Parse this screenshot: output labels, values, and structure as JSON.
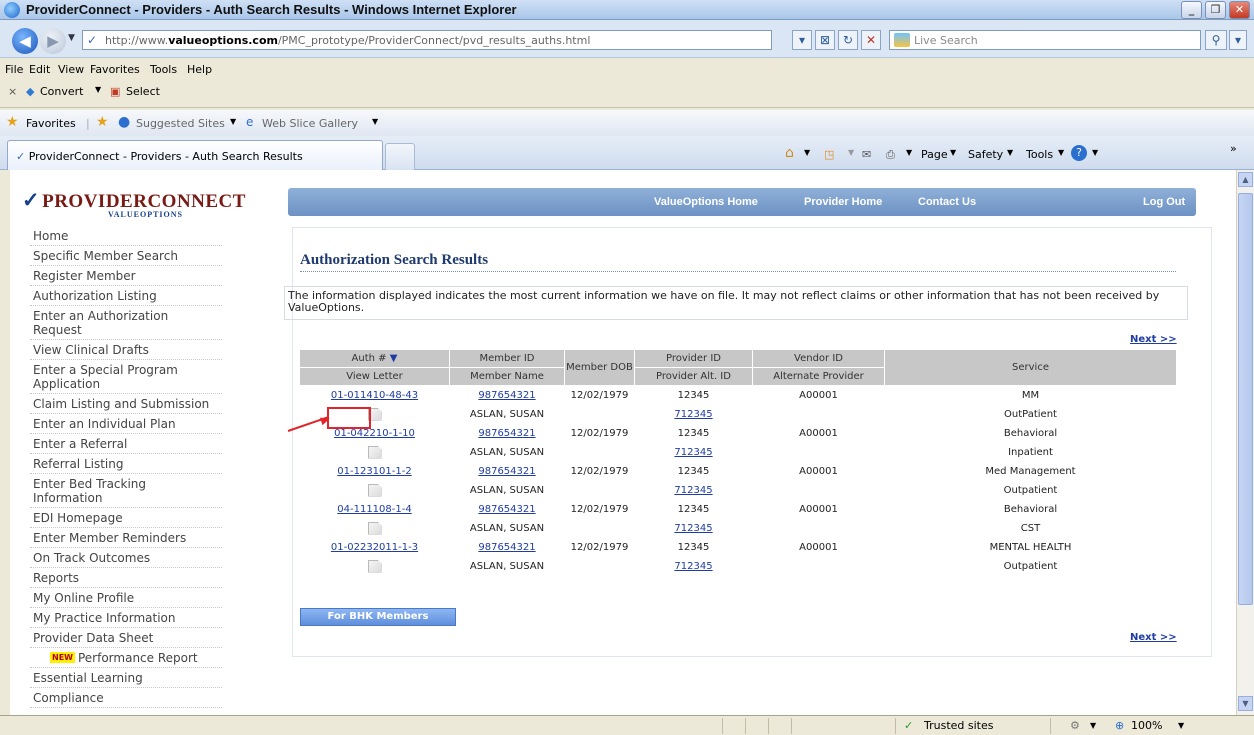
{
  "window": {
    "title": "ProviderConnect - Providers - Auth Search Results - Windows Internet Explorer"
  },
  "address": {
    "url_prefix": "http://www.",
    "url_domain": "valueoptions.com",
    "url_path": "/PMC_prototype/ProviderConnect/pvd_results_auths.html"
  },
  "search": {
    "placeholder": "Live Search"
  },
  "menu": [
    "File",
    "Edit",
    "View",
    "Favorites",
    "Tools",
    "Help"
  ],
  "commands": {
    "close": "×",
    "convert": "Convert",
    "select": "Select"
  },
  "favorites_bar": {
    "favorites": "Favorites",
    "suggested": "Suggested Sites",
    "gallery": "Web Slice Gallery"
  },
  "tab": {
    "label": "ProviderConnect - Providers - Auth Search Results"
  },
  "tab_tools": {
    "page": "Page",
    "safety": "Safety",
    "tools": "Tools"
  },
  "status": {
    "zone": "Trusted sites",
    "zoom": "100%"
  },
  "logo": {
    "name": "PROVIDERCONNECT",
    "sub": "VALUEOPTIONS"
  },
  "topnav": [
    "ValueOptions Home",
    "Provider Home",
    "Contact Us",
    "Log Out"
  ],
  "sidenav": [
    "Home",
    "Specific Member Search",
    "Register Member",
    "Authorization Listing",
    "Enter an Authorization Request",
    "View Clinical Drafts",
    "Enter a Special Program Application",
    "Claim Listing and Submission",
    "Enter an Individual Plan",
    "Enter a Referral",
    "Referral Listing",
    "Enter Bed Tracking Information",
    "EDI Homepage",
    "Enter Member Reminders",
    "On Track Outcomes",
    "Reports",
    "My Online Profile",
    "My Practice Information",
    "Provider Data Sheet",
    "Performance Report",
    "Essential Learning",
    "Compliance"
  ],
  "new_badge": "NEW",
  "page": {
    "title": "Authorization Search Results",
    "notice": "The information displayed indicates the most current information we have on file. It may not reflect claims or other information that has not been received by ValueOptions.",
    "next": "Next >>",
    "bhk_button": "For BHK Members"
  },
  "table": {
    "headers_top": [
      "Auth #",
      "Member ID",
      "Member DOB",
      "Provider ID",
      "Vendor ID",
      "Service"
    ],
    "headers_bottom": [
      "View Letter",
      "Member Name",
      "Provider Alt. ID",
      "Alternate Provider"
    ],
    "sort_glyph": "▼",
    "rows": [
      {
        "auth": "01-011410-48-43",
        "member_id": "987654321",
        "dob": "12/02/1979",
        "provider_id": "12345",
        "vendor_id": "A00001",
        "service": "MM",
        "name": "ASLAN, SUSAN",
        "alt_id": "712345",
        "service2": "OutPatient"
      },
      {
        "auth": "01-042210-1-10",
        "member_id": "987654321",
        "dob": "12/02/1979",
        "provider_id": "12345",
        "vendor_id": "A00001",
        "service": "Behavioral",
        "name": "ASLAN, SUSAN",
        "alt_id": "712345",
        "service2": "Inpatient"
      },
      {
        "auth": "01-123101-1-2",
        "member_id": "987654321",
        "dob": "12/02/1979",
        "provider_id": "12345",
        "vendor_id": "A00001",
        "service": "Med Management",
        "name": "ASLAN, SUSAN",
        "alt_id": "712345",
        "service2": "Outpatient"
      },
      {
        "auth": "04-111108-1-4",
        "member_id": "987654321",
        "dob": "12/02/1979",
        "provider_id": "12345",
        "vendor_id": "A00001",
        "service": "Behavioral",
        "name": "ASLAN, SUSAN",
        "alt_id": "712345",
        "service2": "CST"
      },
      {
        "auth": "01-02232011-1-3",
        "member_id": "987654321",
        "dob": "12/02/1979",
        "provider_id": "12345",
        "vendor_id": "A00001",
        "service": "MENTAL HEALTH",
        "name": "ASLAN, SUSAN",
        "alt_id": "712345",
        "service2": "Outpatient"
      }
    ]
  },
  "icons": {
    "doc": "document-icon",
    "trusted": "check-icon"
  }
}
